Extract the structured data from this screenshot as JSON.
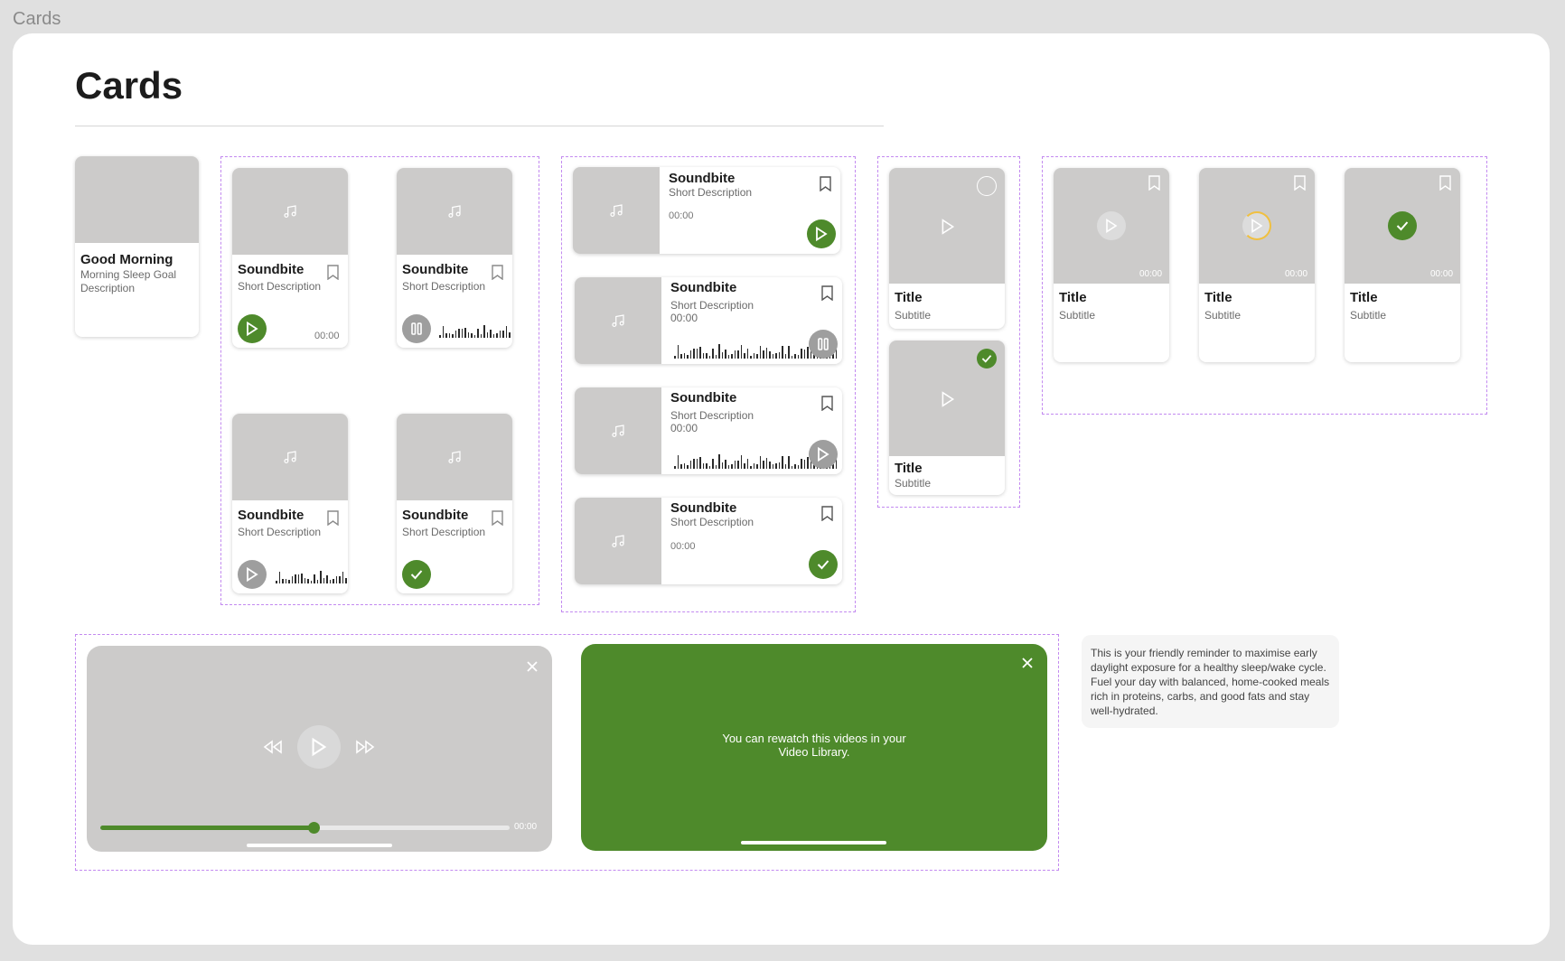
{
  "page_label": "Cards",
  "heading": "Cards",
  "colors": {
    "accent": "#4e8a2b",
    "placeholder": "#cccbca",
    "group_border": "#c38af0",
    "loading_ring": "#f0c040"
  },
  "morning_card": {
    "title": "Good Morning",
    "description": "Morning Sleep Goal Description"
  },
  "soundbite_grid": [
    {
      "title": "Soundbite",
      "description": "Short Description",
      "time": "00:00",
      "state": "play"
    },
    {
      "title": "Soundbite",
      "description": "Short Description",
      "state": "pause"
    },
    {
      "title": "Soundbite",
      "description": "Short Description",
      "state": "play-grey"
    },
    {
      "title": "Soundbite",
      "description": "Short Description",
      "state": "done"
    }
  ],
  "soundbite_list": [
    {
      "title": "Soundbite",
      "description": "Short Description",
      "time": "00:00",
      "state": "play"
    },
    {
      "title": "Soundbite",
      "description": "Short Description",
      "time": "00:00",
      "state": "pause"
    },
    {
      "title": "Soundbite",
      "description": "Short Description",
      "time": "00:00",
      "state": "play-grey"
    },
    {
      "title": "Soundbite",
      "description": "Short Description",
      "time": "00:00",
      "state": "done"
    }
  ],
  "video_tall": [
    {
      "title": "Title",
      "subtitle": "Subtitle",
      "state": "unchecked"
    },
    {
      "title": "Title",
      "subtitle": "Subtitle",
      "state": "checked"
    }
  ],
  "video_small": [
    {
      "title": "Title",
      "subtitle": "Subtitle",
      "time": "00:00",
      "state": "play"
    },
    {
      "title": "Title",
      "subtitle": "Subtitle",
      "time": "00:00",
      "state": "loading"
    },
    {
      "title": "Title",
      "subtitle": "Subtitle",
      "time": "00:00",
      "state": "done"
    }
  ],
  "player": {
    "time": "00:00",
    "progress": 0.52
  },
  "green_modal": {
    "message": "You can rewatch this videos in your Video Library."
  },
  "reminder": {
    "text": "This is your friendly reminder to maximise early daylight exposure for a healthy sleep/wake cycle. Fuel your day with balanced, home-cooked meals rich in proteins, carbs, and good fats and stay well-hydrated."
  }
}
